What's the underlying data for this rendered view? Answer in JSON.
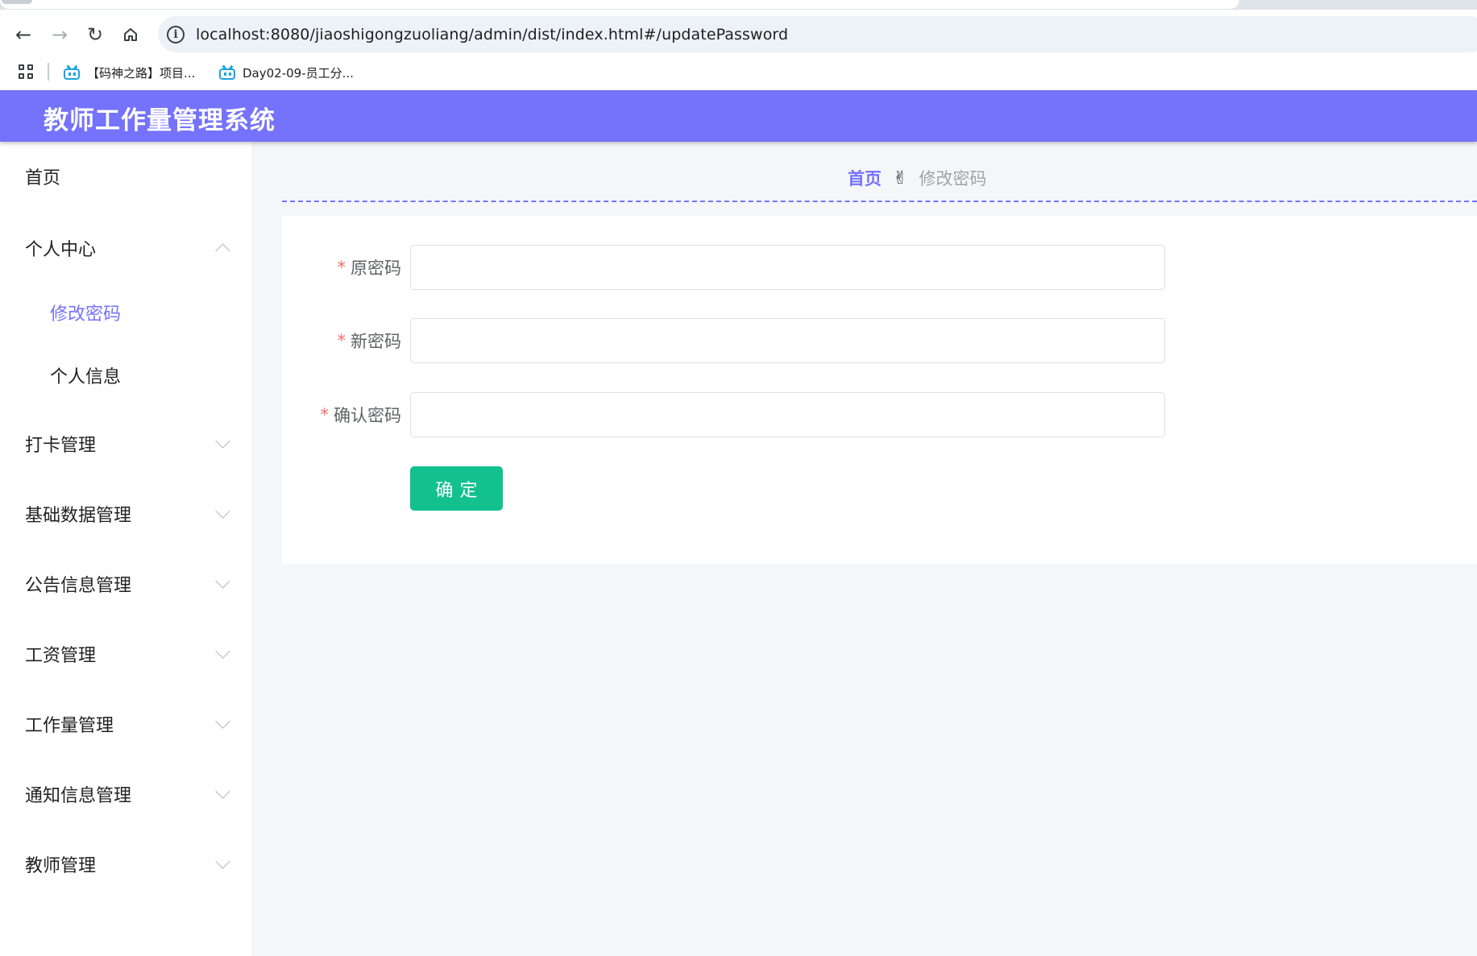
{
  "browser": {
    "url": "localhost:8080/jiaoshigongzuoliang/admin/dist/index.html#/updatePassword",
    "bookmarks": [
      "【码神之路】项目...",
      "Day02-09-员工分..."
    ]
  },
  "app": {
    "title": "教师工作量管理系统"
  },
  "sidebar": {
    "home": "首页",
    "personal_center": {
      "label": "个人中心",
      "children": [
        "修改密码",
        "个人信息"
      ]
    },
    "menus": [
      "打卡管理",
      "基础数据管理",
      "公告信息管理",
      "工资管理",
      "工作量管理",
      "通知信息管理",
      "教师管理"
    ]
  },
  "breadcrumb": {
    "home": "首页",
    "separator_icon": "hand-icon",
    "current": "修改密码"
  },
  "form": {
    "fields": [
      {
        "label": "原密码",
        "value": ""
      },
      {
        "label": "新密码",
        "value": ""
      },
      {
        "label": "确认密码",
        "value": ""
      }
    ],
    "required_mark": "*",
    "submit_label": "确定"
  },
  "colors": {
    "accent": "#7572fb",
    "submit": "#12c18e",
    "required": "#f56c6c"
  }
}
